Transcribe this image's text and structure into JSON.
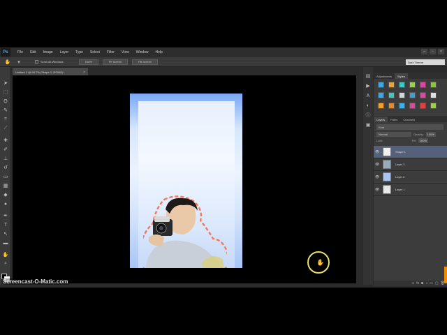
{
  "app": {
    "logo": "Ps"
  },
  "menu": [
    "File",
    "Edit",
    "Image",
    "Layer",
    "Type",
    "Select",
    "Filter",
    "View",
    "Window",
    "Help"
  ],
  "window_controls": [
    "–",
    "▫",
    "×"
  ],
  "options_bar": {
    "scroll_all_label": "Scroll All Windows",
    "buttons": [
      "100%",
      "Fit Screen",
      "Fill Screen"
    ],
    "workspace": "Dark Theme"
  },
  "document": {
    "tab_title": "Untitled-1 @ 66.7% (Shape 1, RGB/8) *",
    "close": "×"
  },
  "panels": {
    "top_tabs": [
      "Adjustments",
      "Styles"
    ],
    "swatches": [
      "#3fa6e0",
      "#e8a23a",
      "#3fc6c0",
      "#9ad04a",
      "#d84aa0",
      "#8ac83a",
      "#3fa6e0",
      "#3fc6c0",
      "#d4d4d4",
      "#3aa0d8",
      "#d84aa0",
      "#e0e0e0",
      "#f0a030",
      "#e08a2a",
      "#3fb0e0",
      "#d84a9a",
      "#e04040",
      "#9ad04a"
    ],
    "layer_tabs": [
      "Layers",
      "Paths",
      "Channels"
    ],
    "kind_label": "Kind",
    "blend_mode": "Normal",
    "opacity_label": "Opacity:",
    "opacity_value": "100%",
    "lock_label": "Lock:",
    "fill_label": "Fill:",
    "fill_value": "100%",
    "layers": [
      {
        "name": "Shape 1",
        "thumb": "#f0f0f0",
        "selected": true
      },
      {
        "name": "Layer 3",
        "thumb": "#9ab",
        "selected": false
      },
      {
        "name": "Layer 2",
        "thumb": "#a9c4f4",
        "selected": false
      },
      {
        "name": "Layer 1",
        "thumb": "#e8e8e8",
        "selected": false
      }
    ]
  },
  "watermark": "Screencast-O-Matic.com"
}
